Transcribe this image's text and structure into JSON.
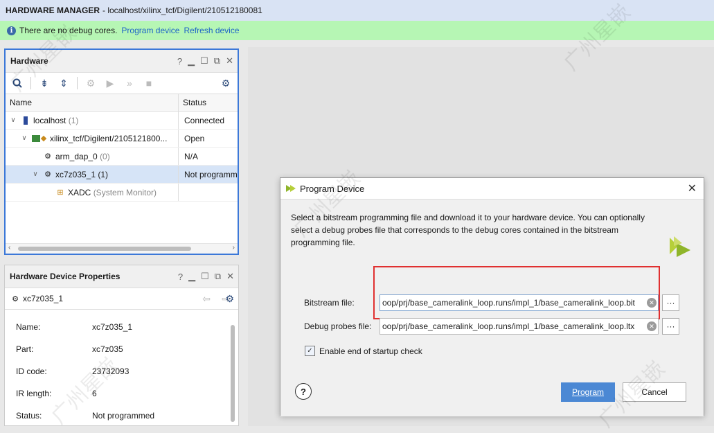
{
  "title": {
    "app": "HARDWARE MANAGER",
    "path": "- localhost/xilinx_tcf/Digilent/210512180081"
  },
  "infobar": {
    "message": "There are no debug cores.",
    "link1": "Program device",
    "link2": "Refresh device"
  },
  "hardware": {
    "title": "Hardware",
    "columns": [
      "Name",
      "Status"
    ],
    "rows": [
      {
        "name": "localhost",
        "suffix": "(1)",
        "status": "Connected"
      },
      {
        "name": "xilinx_tcf/Digilent/2105121800...",
        "suffix": "",
        "status": "Open"
      },
      {
        "name": "arm_dap_0",
        "suffix": "(0)",
        "status": "N/A"
      },
      {
        "name": "xc7z035_1",
        "suffix": "(1)",
        "status": "Not programm"
      },
      {
        "name": "XADC",
        "suffix": "(System Monitor)",
        "status": ""
      }
    ]
  },
  "props": {
    "title": "Hardware Device Properties",
    "device": "xc7z035_1",
    "rows": [
      {
        "k": "Name:",
        "v": "xc7z035_1"
      },
      {
        "k": "Part:",
        "v": "xc7z035"
      },
      {
        "k": "ID code:",
        "v": "23732093"
      },
      {
        "k": "IR length:",
        "v": "6"
      },
      {
        "k": "Status:",
        "v": "Not programmed"
      }
    ]
  },
  "dialog": {
    "title": "Program Device",
    "description": "Select a bitstream programming file and download it to your hardware device. You can optionally select a debug probes file that corresponds to the debug cores contained in the bitstream programming file.",
    "bitstream_label": "Bitstream file:",
    "bitstream_value": "oop/prj/base_cameralink_loop.runs/impl_1/base_cameralink_loop.bit",
    "probes_label": "Debug probes file:",
    "probes_value": "oop/prj/base_cameralink_loop.runs/impl_1/base_cameralink_loop.ltx",
    "checkbox_label": "Enable end of startup check",
    "program": "Program",
    "cancel": "Cancel",
    "help": "?",
    "browse": "···"
  },
  "watermark": "广州星嵌",
  "icons": {
    "info": "info-icon",
    "close": "close-icon",
    "help": "help-icon"
  },
  "colors": {
    "accent": "#4b88d4",
    "highlight": "#e03030",
    "infobar": "#b6f6b4"
  }
}
